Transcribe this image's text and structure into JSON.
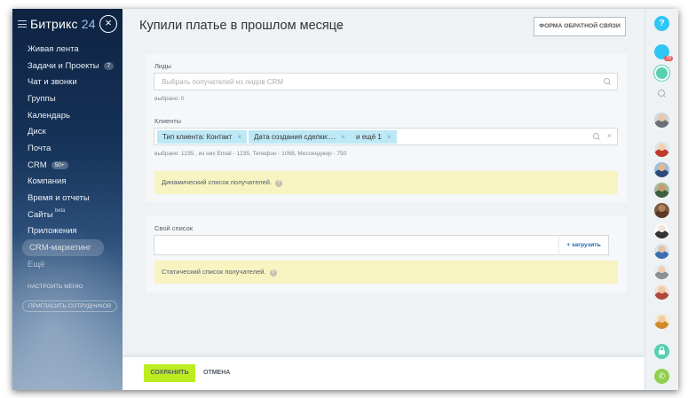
{
  "sidebar": {
    "logo_name": "Битрикс",
    "logo_number": "24",
    "close_symbol": "×",
    "items": [
      {
        "label": "Живая лента"
      },
      {
        "label": "Задачи и Проекты",
        "badge": "7"
      },
      {
        "label": "Чат и звонки"
      },
      {
        "label": "Группы"
      },
      {
        "label": "Календарь"
      },
      {
        "label": "Диск"
      },
      {
        "label": "Почта"
      },
      {
        "label": "CRM",
        "badge": "50+"
      },
      {
        "label": "Компания"
      },
      {
        "label": "Время и отчеты"
      },
      {
        "label": "Сайты",
        "sup": "beta"
      },
      {
        "label": "Приложения"
      },
      {
        "label": "CRM-маркетинг"
      },
      {
        "label": "Ещё"
      }
    ],
    "settings_label": "настроить меню",
    "invite_label": "пригласить сотрудников"
  },
  "header": {
    "title": "Купили платье в прошлом месяце",
    "edit_symbol": "✎",
    "feedback_button": "Форма обратной связи"
  },
  "leads": {
    "label": "Лиды",
    "placeholder": "Выбрать получателей из лидов CRM",
    "selected": "выбрано: 0"
  },
  "clients": {
    "label": "Клиенты",
    "tags": [
      "Тип клиента: Контакт",
      "Дата создания сделки:…",
      "и ещё 1"
    ],
    "tag_remove": "×",
    "clear": "×",
    "selected": "выбрано: 1235 , из них Email - 1235, Телефон - 1068, Мессенджер - 750",
    "note": "Динамический список получателей."
  },
  "own_list": {
    "label": "Свой список",
    "upload_button": "+ загрузить",
    "note": "Статический список получателей."
  },
  "footer": {
    "save_button": "Сохранить",
    "cancel_button": "Отмена"
  },
  "rightbar": {
    "help_symbol": "?",
    "notifications_count": "29",
    "phone_symbol": "✆"
  },
  "colors": {
    "accent": "#bbed21",
    "tag": "#bde8f6",
    "note": "#f8f4c2",
    "link": "#2067b0"
  }
}
